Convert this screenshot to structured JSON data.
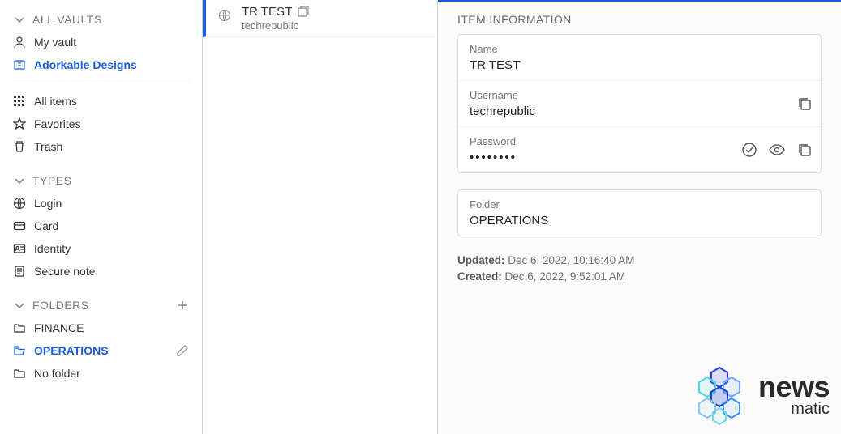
{
  "sidebar": {
    "section_vaults": "ALL VAULTS",
    "my_vault": "My vault",
    "org_vault": "Adorkable Designs",
    "all_items": "All items",
    "favorites": "Favorites",
    "trash": "Trash",
    "section_types": "TYPES",
    "type_login": "Login",
    "type_card": "Card",
    "type_identity": "Identity",
    "type_note": "Secure note",
    "section_folders": "FOLDERS",
    "folder_finance": "FINANCE",
    "folder_operations": "OPERATIONS",
    "folder_none": "No folder"
  },
  "list": {
    "item": {
      "title": "TR TEST",
      "subtitle": "techrepublic"
    }
  },
  "detail": {
    "header": "ITEM INFORMATION",
    "name_label": "Name",
    "name_value": "TR TEST",
    "username_label": "Username",
    "username_value": "techrepublic",
    "password_label": "Password",
    "password_value": "••••••••",
    "folder_label": "Folder",
    "folder_value": "OPERATIONS",
    "updated_label": "Updated:",
    "updated_value": "Dec 6, 2022, 10:16:40 AM",
    "created_label": "Created:",
    "created_value": "Dec 6, 2022, 9:52:01 AM"
  },
  "logo": {
    "line1": "news",
    "line2": "matic"
  }
}
